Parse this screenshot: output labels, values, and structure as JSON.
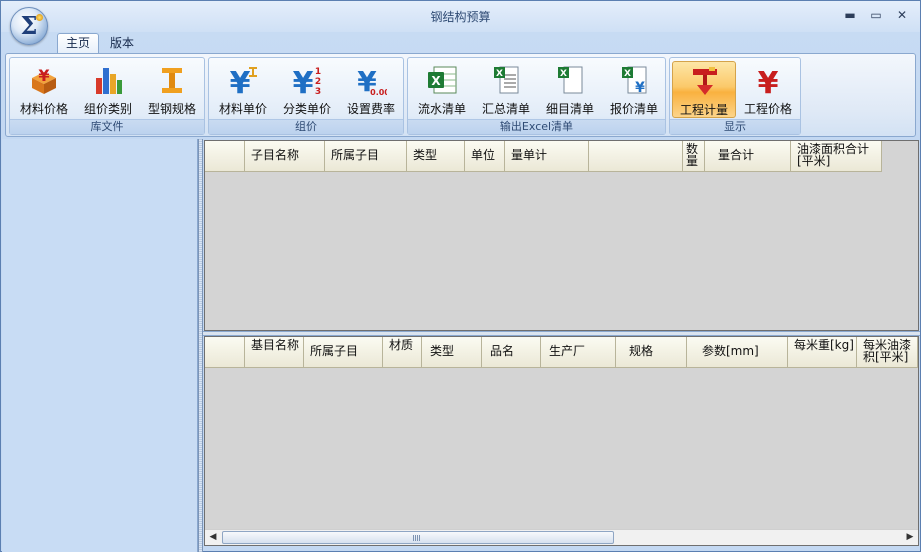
{
  "window": {
    "title": "钢结构预算",
    "controls": {
      "minimize": "▬",
      "maximize": "▭",
      "close": "✕"
    }
  },
  "app_orb": {
    "glyph": "Σ"
  },
  "tabs": [
    {
      "label": "主页",
      "active": true
    },
    {
      "label": "版本",
      "active": false
    }
  ],
  "ribbon": {
    "groups": [
      {
        "label": "库文件",
        "buttons": [
          {
            "label": "材料价格",
            "icon": "material-price-icon"
          },
          {
            "label": "组价类别",
            "icon": "price-category-icon"
          },
          {
            "label": "型钢规格",
            "icon": "steel-section-icon"
          }
        ]
      },
      {
        "label": "组价",
        "buttons": [
          {
            "label": "材料单价",
            "icon": "material-unit-price-icon"
          },
          {
            "label": "分类单价",
            "icon": "category-unit-price-icon"
          },
          {
            "label": "设置费率",
            "icon": "set-rate-icon"
          }
        ]
      },
      {
        "label": "输出Excel清单",
        "buttons": [
          {
            "label": "流水清单",
            "icon": "excel-icon"
          },
          {
            "label": "汇总清单",
            "icon": "excel-summary-icon"
          },
          {
            "label": "细目清单",
            "icon": "excel-detail-icon"
          },
          {
            "label": "报价清单",
            "icon": "excel-quote-icon"
          }
        ]
      },
      {
        "label": "显示",
        "buttons": [
          {
            "label": "工程计量",
            "icon": "measurement-icon",
            "active": true
          },
          {
            "label": "工程价格",
            "icon": "project-price-icon"
          }
        ]
      }
    ],
    "icon_text": {
      "yuan": "¥",
      "num_1": "1",
      "num_2": "2",
      "num_3": "3",
      "rate": "0.00",
      "excel": "X"
    }
  },
  "top_grid": {
    "columns": [
      "子目名称",
      "所属子目",
      "类型",
      "单位",
      "量单计",
      "数量",
      "量合计",
      "油漆面积合计[平米]"
    ]
  },
  "bottom_grid": {
    "columns": [
      "基目名称",
      "所属子目",
      "材质",
      "类型",
      "品名",
      "生产厂",
      "规格",
      "参数[mm]",
      "每米重[kg]",
      "每米油漆积[平米]"
    ]
  },
  "scrollbar": {
    "left_arrow": "◀",
    "right_arrow": "▶"
  },
  "colors": {
    "ribbon_active": "#fbc96a",
    "grid_header": "#ebe8d6",
    "grid_background": "#d4d4d4",
    "left_panel": "#c8dcf4",
    "excel_green": "#1e7b34",
    "yuan_blue": "#1f6fc4",
    "yuan_red": "#c81e1e"
  }
}
